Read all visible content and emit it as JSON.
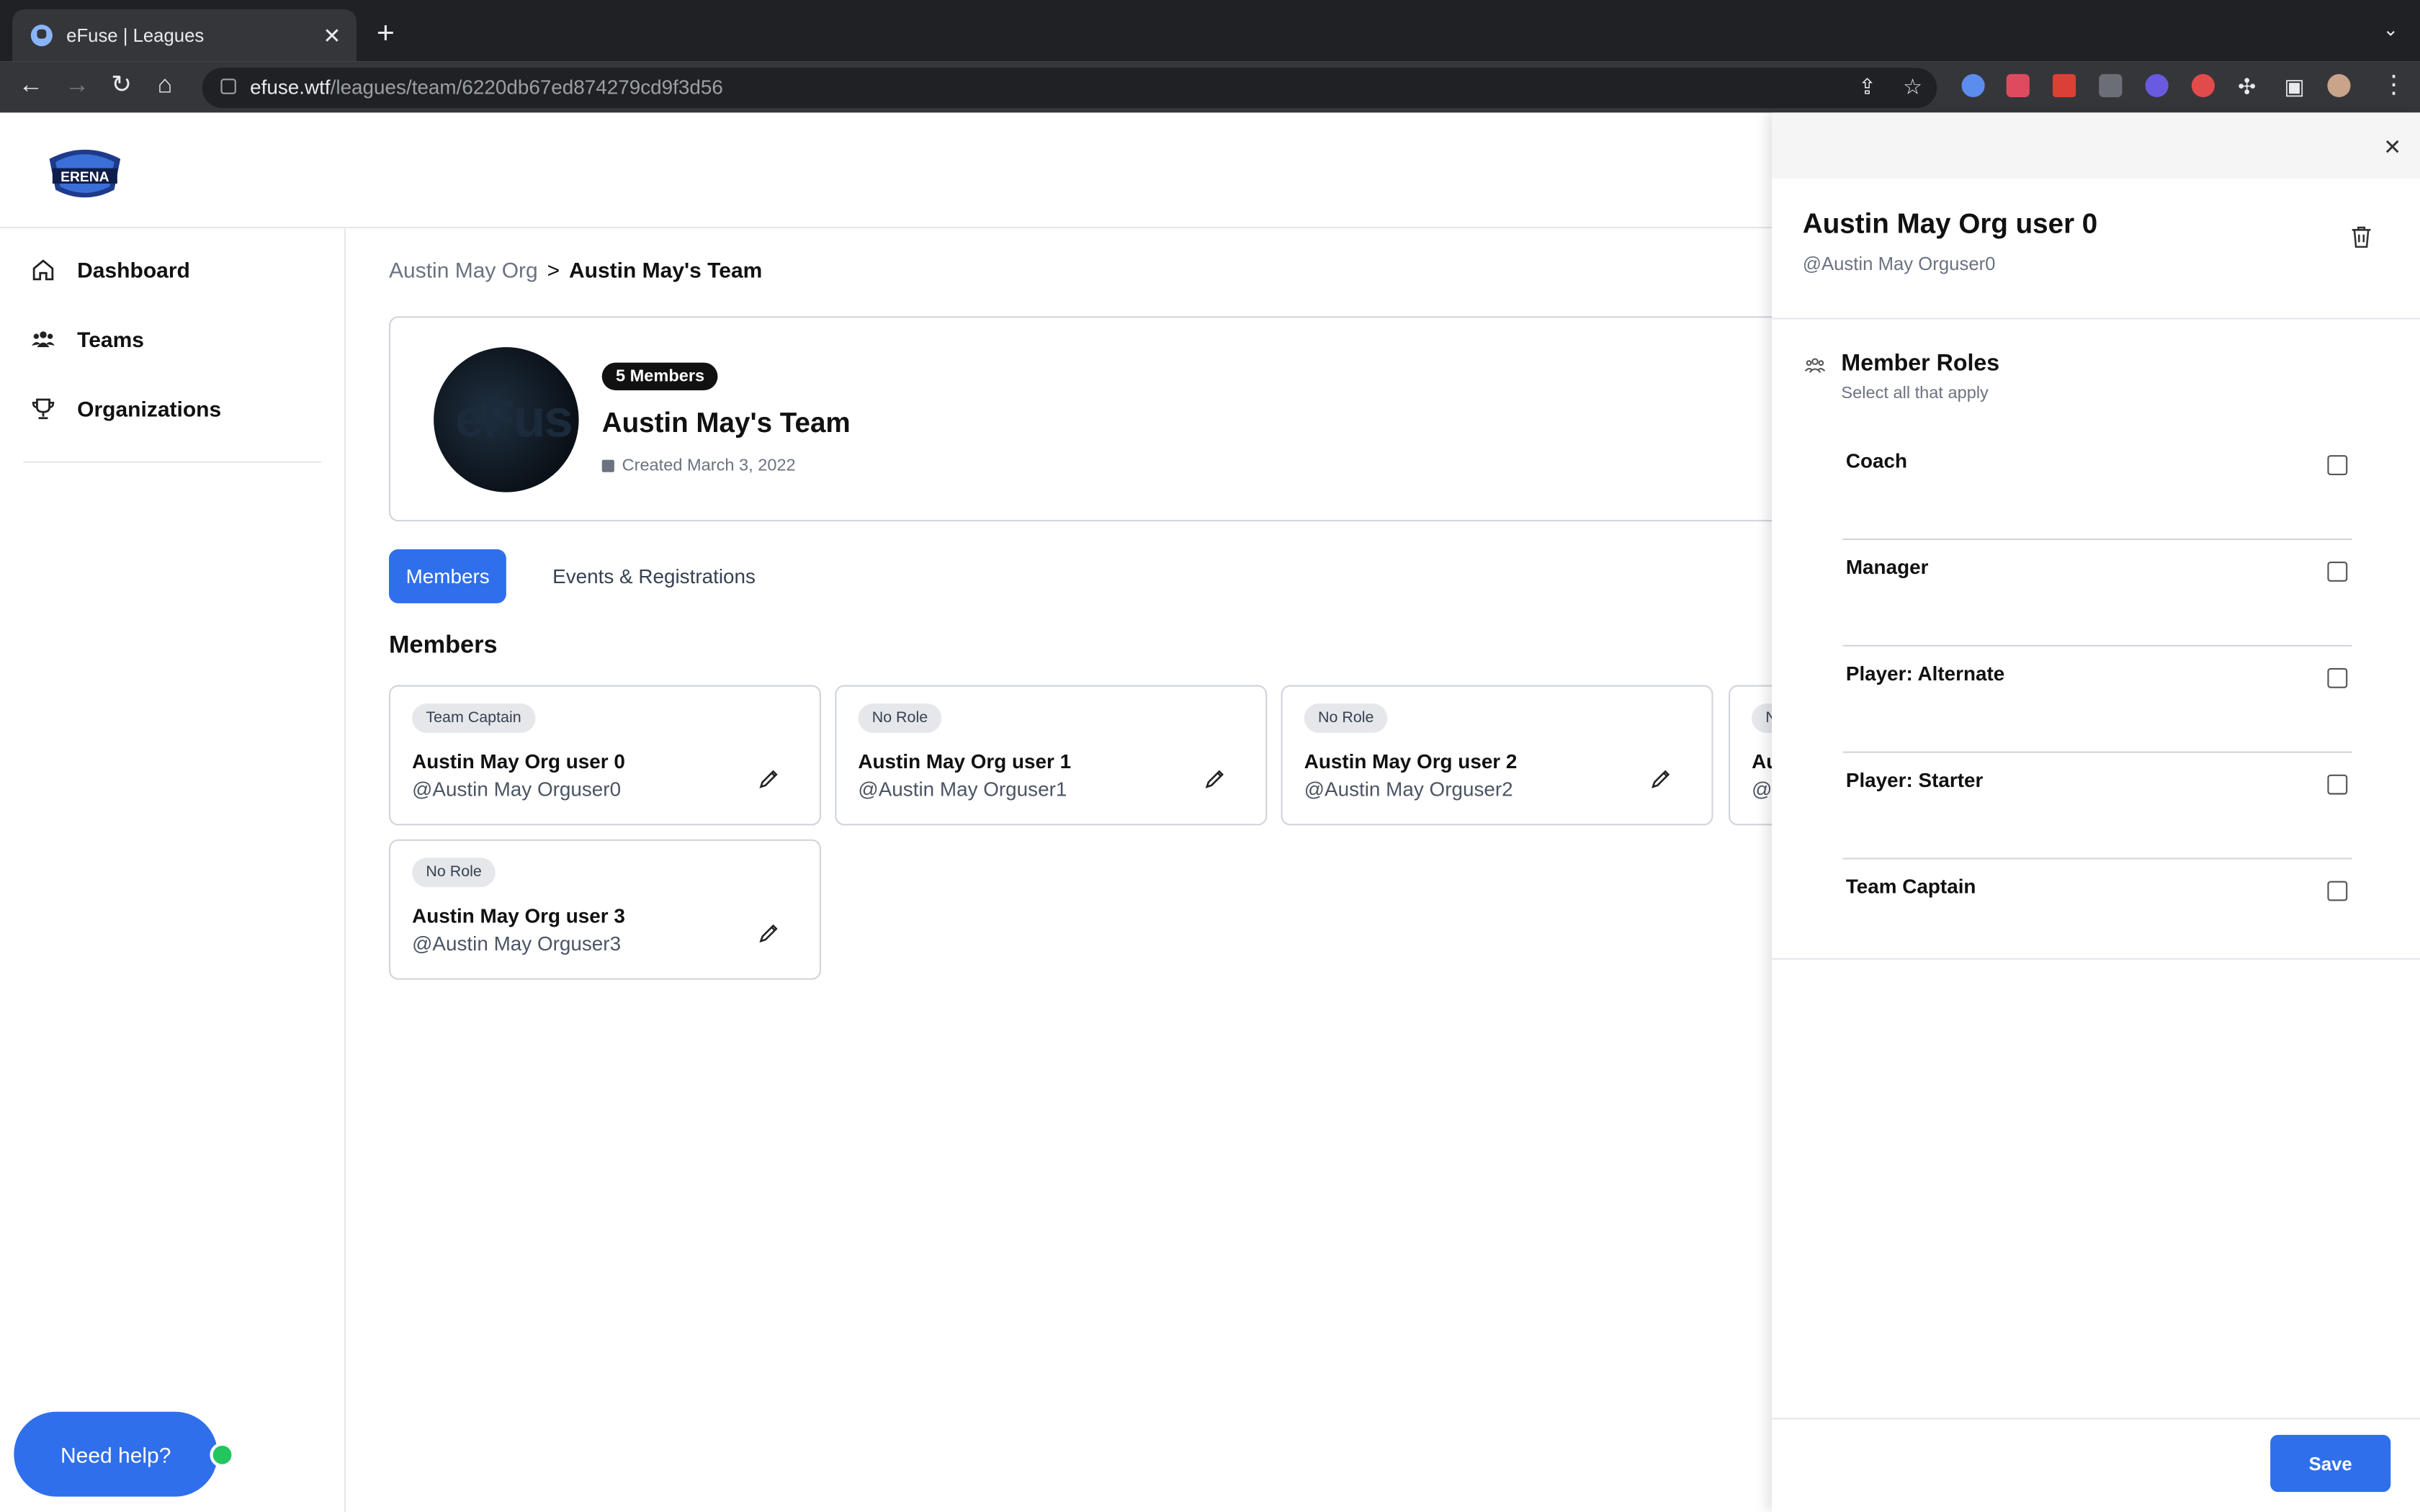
{
  "browser": {
    "tab_title": "eFuse | Leagues",
    "url_host": "efuse.wtf",
    "url_path": "/leagues/team/6220db67ed874279cd9f3d56"
  },
  "sidebar": {
    "items": [
      {
        "label": "Dashboard",
        "icon": "home-icon"
      },
      {
        "label": "Teams",
        "icon": "users-icon"
      },
      {
        "label": "Organizations",
        "icon": "trophy-icon"
      }
    ]
  },
  "breadcrumb": {
    "parent": "Austin May Org",
    "separator": ">",
    "current": "Austin May's Team"
  },
  "team": {
    "member_count_badge": "5 Members",
    "name": "Austin May's Team",
    "created": "Created March 3, 2022",
    "avatar_text": "eFus"
  },
  "tabs": {
    "members": "Members",
    "events": "Events & Registrations"
  },
  "members_heading": "Members",
  "members": [
    {
      "role": "Team Captain",
      "name": "Austin May Org user 0",
      "handle": "@Austin May Orguser0"
    },
    {
      "role": "No Role",
      "name": "Austin May Org user 1",
      "handle": "@Austin May Orguser1"
    },
    {
      "role": "No Role",
      "name": "Austin May Org user 2",
      "handle": "@Austin May Orguser2"
    },
    {
      "role": "N",
      "name": "Au",
      "handle": "@"
    },
    {
      "role": "No Role",
      "name": "Austin May Org user 3",
      "handle": "@Austin May Orguser3"
    }
  ],
  "help": {
    "label": "Need help?"
  },
  "drawer": {
    "title": "Austin May Org user 0",
    "handle": "@Austin May Orguser0",
    "roles_heading": "Member Roles",
    "roles_sub": "Select all that apply",
    "roles": [
      {
        "label": "Coach",
        "checked": false
      },
      {
        "label": "Manager",
        "checked": false
      },
      {
        "label": "Player: Alternate",
        "checked": false
      },
      {
        "label": "Player: Starter",
        "checked": false
      },
      {
        "label": "Team Captain",
        "checked": false
      }
    ],
    "save_label": "Save"
  },
  "colors": {
    "accent": "#2f6fec",
    "status_online": "#22c55e"
  }
}
